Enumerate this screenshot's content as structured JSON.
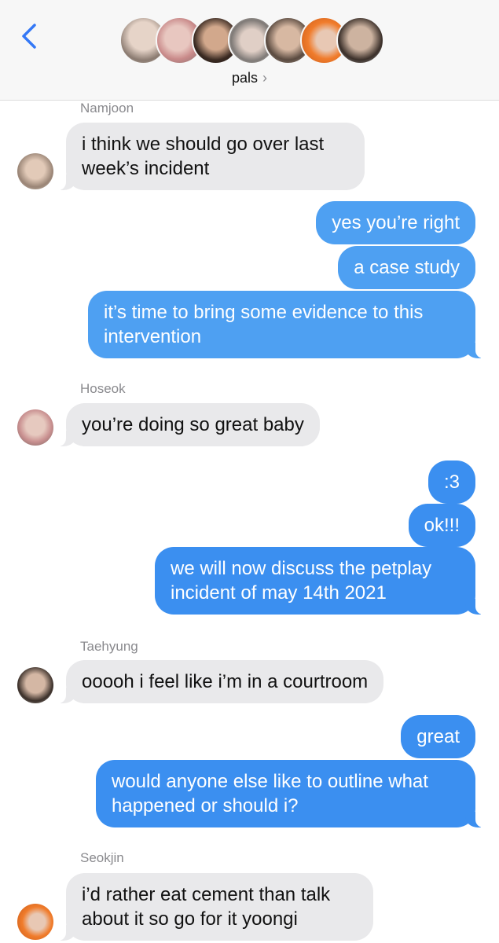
{
  "header": {
    "group_name": "pals",
    "chevron": "›",
    "back_icon": "chevron-left-icon",
    "accent_color": "#3478f6"
  },
  "messages": [
    {
      "sender": "Namjoon",
      "text": "i think we should go over last\nweek’s incident"
    },
    {
      "text": "yes you’re right"
    },
    {
      "text": "a case study"
    },
    {
      "text": "it’s time to bring some evidence to this\nintervention"
    },
    {
      "sender": "Hoseok",
      "text": "you’re doing so great baby"
    },
    {
      "text": ":3"
    },
    {
      "text": "ok!!!"
    },
    {
      "text": "we will now discuss the petplay\nincident of may 14th 2021"
    },
    {
      "sender": "Taehyung",
      "text": "ooooh i feel like i’m in a courtroom"
    },
    {
      "text": "great"
    },
    {
      "text": "would anyone else like to outline what\nhappened or should i?"
    },
    {
      "sender": "Seokjin",
      "text": "i’d rather eat cement than talk\nabout it so go for it yoongi"
    }
  ],
  "colors": {
    "incoming_bubble": "#e9e9eb",
    "outgoing_bubble": "#3b8ff0",
    "header_bg": "#f7f7f7"
  }
}
